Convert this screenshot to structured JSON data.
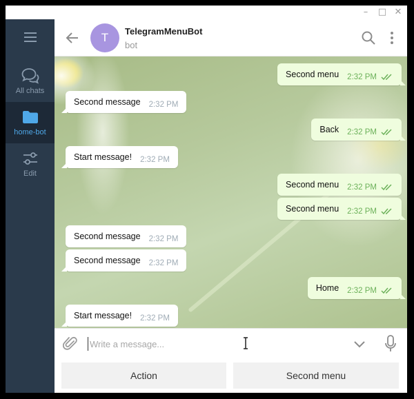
{
  "window": {
    "controls": [
      "–",
      "□",
      "✕"
    ]
  },
  "sidebar": {
    "menu_icon": "hamburger-icon",
    "items": [
      {
        "label": "All chats",
        "icon": "chat-bubbles-icon",
        "active": false
      },
      {
        "label": "home-bot",
        "icon": "folder-icon",
        "active": true
      },
      {
        "label": "Edit",
        "icon": "sliders-icon",
        "active": false
      }
    ]
  },
  "header": {
    "avatar_letter": "T",
    "title": "TelegramMenuBot",
    "subtitle": "bot",
    "avatar_color": "#a895e0"
  },
  "messages": [
    {
      "text": "Second menu",
      "time": "2:32 PM",
      "direction": "out",
      "read": true
    },
    {
      "text": "Second message",
      "time": "2:32 PM",
      "direction": "in"
    },
    {
      "text": "Back",
      "time": "2:32 PM",
      "direction": "out",
      "read": true
    },
    {
      "text": "Start message!",
      "time": "2:32 PM",
      "direction": "in"
    },
    {
      "text": "Second menu",
      "time": "2:32 PM",
      "direction": "out",
      "read": true
    },
    {
      "text": "Second menu",
      "time": "2:32 PM",
      "direction": "out",
      "read": true
    },
    {
      "text": "Second message",
      "time": "2:32 PM",
      "direction": "in"
    },
    {
      "text": "Second message",
      "time": "2:32 PM",
      "direction": "in"
    },
    {
      "text": "Home",
      "time": "2:32 PM",
      "direction": "out",
      "read": true
    },
    {
      "text": "Start message!",
      "time": "2:32 PM",
      "direction": "in"
    }
  ],
  "composer": {
    "placeholder": "Write a message...",
    "value": ""
  },
  "keyboard": {
    "buttons": [
      "Action",
      "Second menu"
    ]
  },
  "colors": {
    "sidebar_bg": "#2a3a4b",
    "accent": "#4fa8e8",
    "outgoing_bubble": "#effdde",
    "check_color": "#6cb15a"
  }
}
